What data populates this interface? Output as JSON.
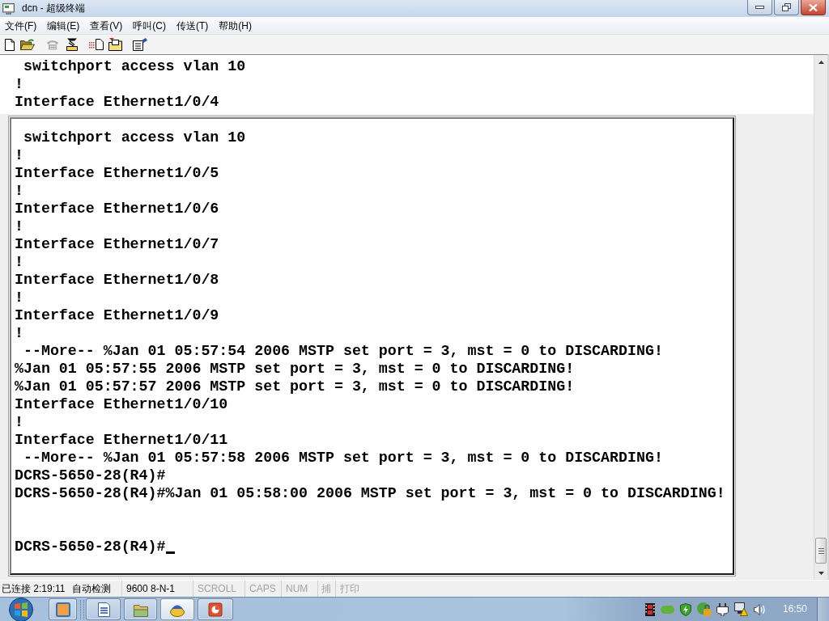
{
  "window": {
    "title": "dcn - 超级终端"
  },
  "menu": [
    "文件(F)",
    "编辑(E)",
    "查看(V)",
    "呼叫(C)",
    "传送(T)",
    "帮助(H)"
  ],
  "toolbar": [
    {
      "disabled": false
    },
    {
      "disabled": false
    },
    {
      "disabled": true
    },
    {
      "disabled": false
    },
    {
      "disabled": false
    },
    {
      "disabled": false
    },
    {
      "disabled": false
    }
  ],
  "terminal": {
    "scrollback": [
      " switchport access vlan 10",
      "!",
      "Interface Ethernet1/0/4"
    ],
    "lines": [
      " switchport access vlan 10",
      "!",
      "Interface Ethernet1/0/5",
      "!",
      "Interface Ethernet1/0/6",
      "!",
      "Interface Ethernet1/0/7",
      "!",
      "Interface Ethernet1/0/8",
      "!",
      "Interface Ethernet1/0/9",
      "!",
      " --More-- %Jan 01 05:57:54 2006 MSTP set port = 3, mst = 0 to DISCARDING!",
      "%Jan 01 05:57:55 2006 MSTP set port = 3, mst = 0 to DISCARDING!",
      "%Jan 01 05:57:57 2006 MSTP set port = 3, mst = 0 to DISCARDING!",
      "Interface Ethernet1/0/10",
      "!",
      "Interface Ethernet1/0/11",
      " --More-- %Jan 01 05:57:58 2006 MSTP set port = 3, mst = 0 to DISCARDING!",
      "DCRS-5650-28(R4)#",
      "DCRS-5650-28(R4)#%Jan 01 05:58:00 2006 MSTP set port = 3, mst = 0 to DISCARDING!"
    ],
    "prompt": "DCRS-5650-28(R4)#"
  },
  "status_bar": [
    {
      "text": "已连接 2:19:11",
      "enabled": true
    },
    {
      "text": "自动检测",
      "enabled": true
    },
    {
      "text": "9600 8-N-1",
      "enabled": true
    },
    {
      "text": "SCROLL",
      "enabled": false
    },
    {
      "text": "CAPS",
      "enabled": false
    },
    {
      "text": "NUM",
      "enabled": false
    },
    {
      "text": "捕",
      "enabled": false
    },
    {
      "text": "打印",
      "enabled": false
    }
  ],
  "taskbar": {
    "buttons": [
      {
        "selected": false
      },
      {
        "selected": false
      },
      {
        "selected": false
      },
      {
        "selected": true
      },
      {
        "selected": false
      }
    ],
    "clock": "16:50"
  }
}
